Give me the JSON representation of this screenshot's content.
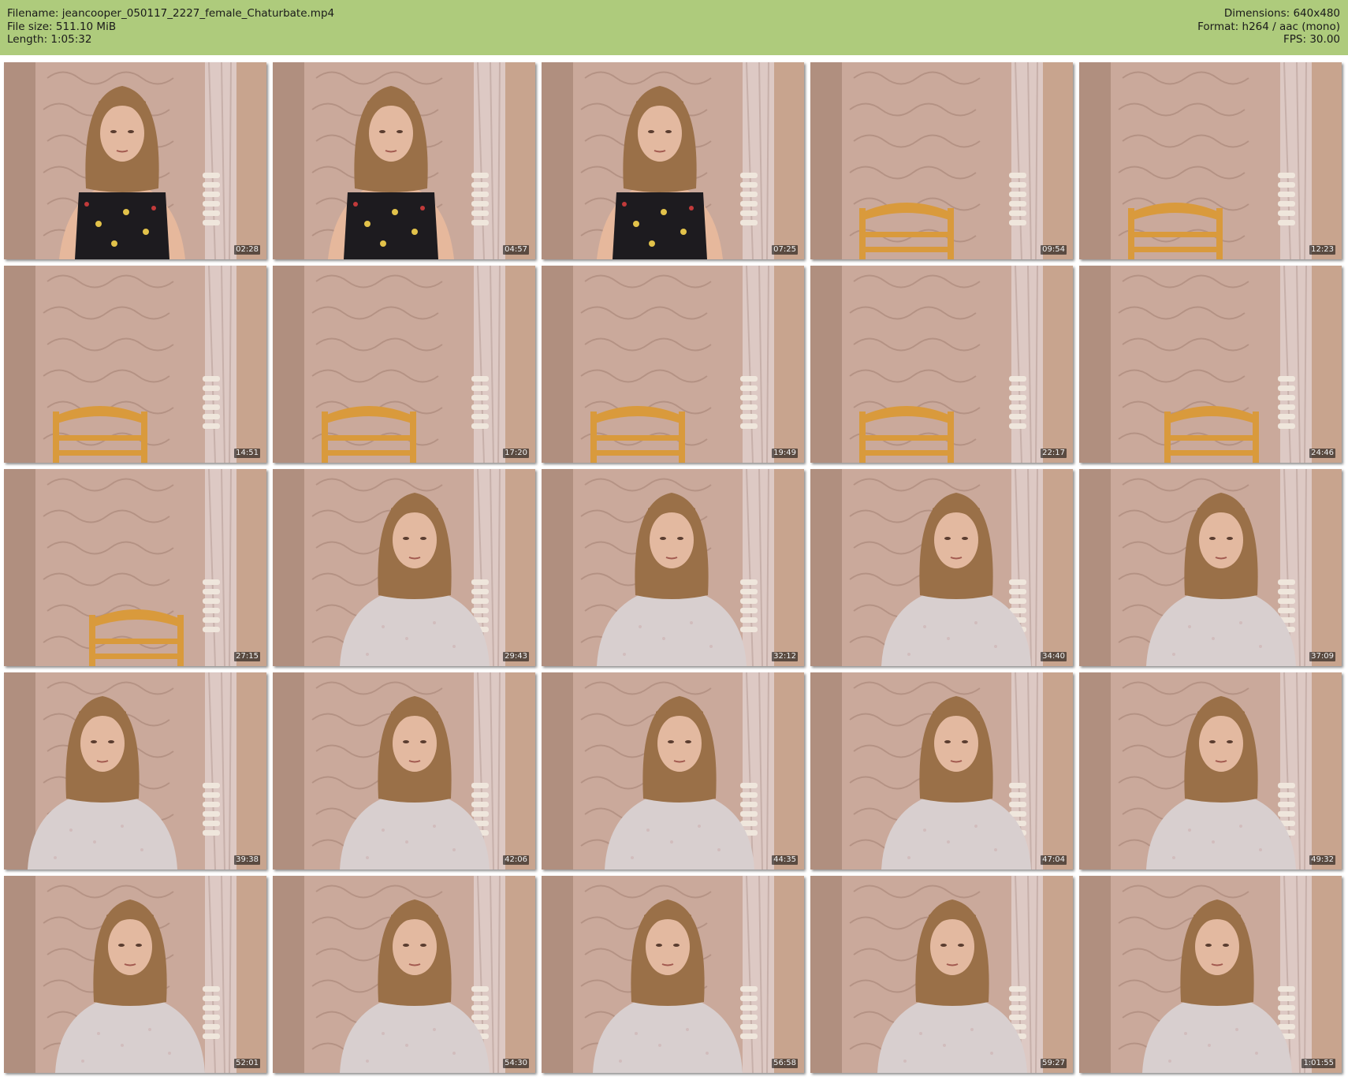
{
  "header": {
    "filename_label": "Filename:",
    "filename": "jeancooper_050117_2227_female_Chaturbate.mp4",
    "filesize_label": "File size:",
    "filesize": "511.10 MiB",
    "length_label": "Length:",
    "length": "1:05:32",
    "dimensions_label": "Dimensions:",
    "dimensions": "640x480",
    "format_label": "Format:",
    "format": "h264 / aac (mono)",
    "fps_label": "FPS:",
    "fps": "30.00"
  },
  "colors": {
    "header_bg": "#aecb7c",
    "wall": "#c9a99a",
    "curtain": "#ddc9c4",
    "chair": "#d99a3c",
    "hair": "#9a7048",
    "top_dark": "#1d1b1f",
    "sweater": "#d8cfcf"
  },
  "frames": [
    {
      "time": "02:28",
      "scene": "dark-top"
    },
    {
      "time": "04:57",
      "scene": "dark-top"
    },
    {
      "time": "07:25",
      "scene": "dark-top"
    },
    {
      "time": "09:54",
      "scene": "empty-chair"
    },
    {
      "time": "12:23",
      "scene": "empty-chair"
    },
    {
      "time": "14:51",
      "scene": "empty-chair"
    },
    {
      "time": "17:20",
      "scene": "empty-chair"
    },
    {
      "time": "19:49",
      "scene": "empty-chair"
    },
    {
      "time": "22:17",
      "scene": "empty-chair"
    },
    {
      "time": "24:46",
      "scene": "empty-chair"
    },
    {
      "time": "27:15",
      "scene": "empty-chair"
    },
    {
      "time": "29:43",
      "scene": "sweater"
    },
    {
      "time": "32:12",
      "scene": "sweater"
    },
    {
      "time": "34:40",
      "scene": "sweater"
    },
    {
      "time": "37:09",
      "scene": "sweater"
    },
    {
      "time": "39:38",
      "scene": "sweater"
    },
    {
      "time": "42:06",
      "scene": "sweater"
    },
    {
      "time": "44:35",
      "scene": "sweater"
    },
    {
      "time": "47:04",
      "scene": "sweater"
    },
    {
      "time": "49:32",
      "scene": "sweater"
    },
    {
      "time": "52:01",
      "scene": "sweater"
    },
    {
      "time": "54:30",
      "scene": "sweater"
    },
    {
      "time": "56:58",
      "scene": "sweater"
    },
    {
      "time": "59:27",
      "scene": "sweater"
    },
    {
      "time": "1:01:55",
      "scene": "sweater"
    }
  ]
}
